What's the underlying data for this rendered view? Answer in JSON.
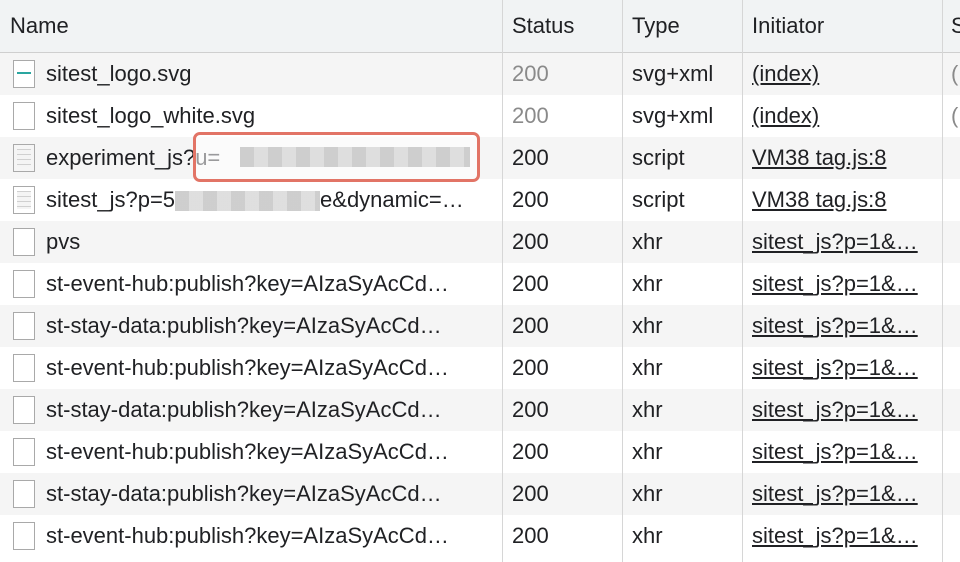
{
  "columns": {
    "name": "Name",
    "status": "Status",
    "type": "Type",
    "initiator": "Initiator",
    "size": "S"
  },
  "rows": [
    {
      "name": "sitest_logo.svg",
      "status": "200",
      "type": "svg+xml",
      "initiator": "(index)",
      "size": "(",
      "icon": "svg-image-icon",
      "status_dim": true
    },
    {
      "name": "sitest_logo_white.svg",
      "status": "200",
      "type": "svg+xml",
      "initiator": "(index)",
      "size": "(",
      "icon": "file-icon",
      "status_dim": true
    },
    {
      "name": "experiment_js?u=",
      "status": "200",
      "type": "script",
      "initiator": "VM38 tag.js:8",
      "size": "",
      "icon": "script-file-icon",
      "status_dim": false,
      "redacted": true
    },
    {
      "name_prefix": "sitest_js?p=5",
      "name_suffix": "e&dynamic=…",
      "status": "200",
      "type": "script",
      "initiator": "VM38 tag.js:8",
      "size": "",
      "icon": "script-file-icon",
      "status_dim": false,
      "redacted": true
    },
    {
      "name": "pvs",
      "status": "200",
      "type": "xhr",
      "initiator": "sitest_js?p=1&…",
      "size": "",
      "icon": "file-icon"
    },
    {
      "name": "st-event-hub:publish?key=AIzaSyAcCd…",
      "status": "200",
      "type": "xhr",
      "initiator": "sitest_js?p=1&…",
      "size": "",
      "icon": "file-icon"
    },
    {
      "name": "st-stay-data:publish?key=AIzaSyAcCd…",
      "status": "200",
      "type": "xhr",
      "initiator": "sitest_js?p=1&…",
      "size": "",
      "icon": "file-icon"
    },
    {
      "name": "st-event-hub:publish?key=AIzaSyAcCd…",
      "status": "200",
      "type": "xhr",
      "initiator": "sitest_js?p=1&…",
      "size": "",
      "icon": "file-icon"
    },
    {
      "name": "st-stay-data:publish?key=AIzaSyAcCd…",
      "status": "200",
      "type": "xhr",
      "initiator": "sitest_js?p=1&…",
      "size": "",
      "icon": "file-icon"
    },
    {
      "name": "st-event-hub:publish?key=AIzaSyAcCd…",
      "status": "200",
      "type": "xhr",
      "initiator": "sitest_js?p=1&…",
      "size": "",
      "icon": "file-icon"
    },
    {
      "name": "st-stay-data:publish?key=AIzaSyAcCd…",
      "status": "200",
      "type": "xhr",
      "initiator": "sitest_js?p=1&…",
      "size": "",
      "icon": "file-icon"
    },
    {
      "name": "st-event-hub:publish?key=AIzaSyAcCd…",
      "status": "200",
      "type": "xhr",
      "initiator": "sitest_js?p=1&…",
      "size": "",
      "icon": "file-icon"
    }
  ],
  "colors": {
    "highlight_border": "#e27466",
    "header_bg": "#f1f3f4",
    "alt_row_bg": "#f5f5f5"
  }
}
